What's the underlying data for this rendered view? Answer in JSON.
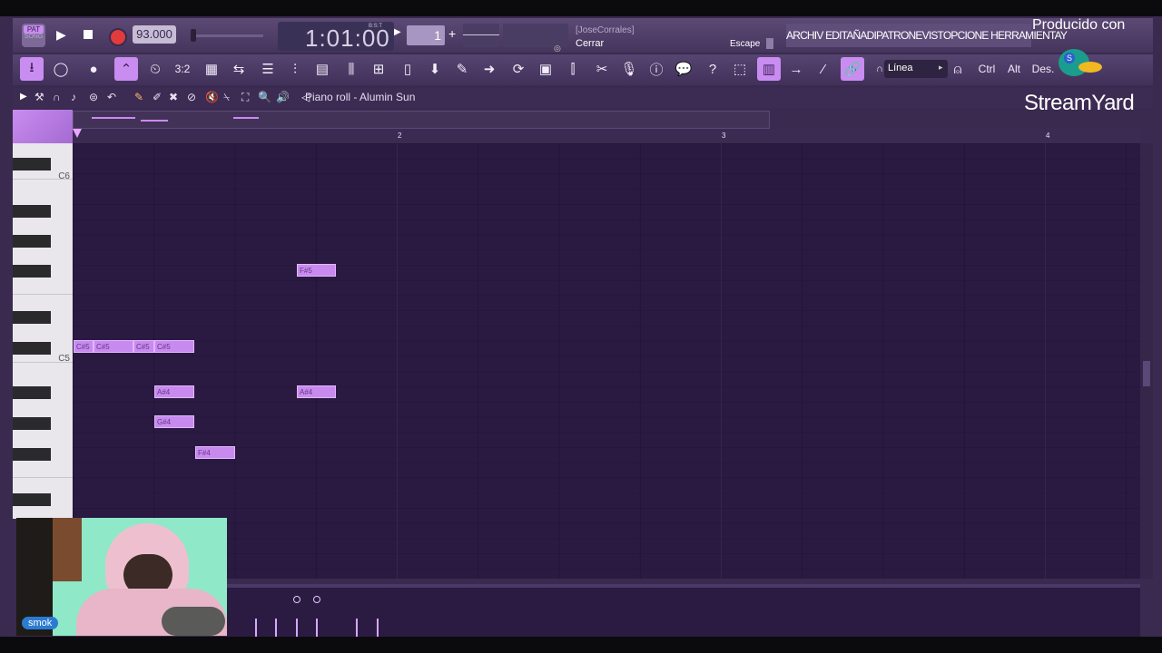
{
  "transport": {
    "pat_label": "PAT",
    "song_label": "SONG",
    "tempo": "93.000",
    "time": "1:01:00",
    "time_unit": "B:S:T",
    "pattern_number": "1",
    "hint_user": "[JoseCorrales]",
    "hint_text": "Cerrar",
    "hint_key": "Escape"
  },
  "menu": {
    "text": "ARCHIV EDITAÑADIPATRONEVISTOPCIONE HERRAMIENTAY"
  },
  "toolbar": {
    "snap_label": "Línea",
    "ctrl_label": "Ctrl",
    "alt_label": "Alt",
    "des_label": "Des."
  },
  "piano_roll": {
    "title": "Piano roll - Alumin Sun",
    "ruler_labels": [
      "2",
      "3",
      "4"
    ],
    "key_labels": [
      "C6",
      "C5"
    ],
    "notes": [
      {
        "label": "F#5"
      },
      {
        "label": "C#5"
      },
      {
        "label": "C#5"
      },
      {
        "label": "C#5"
      },
      {
        "label": "C#5"
      },
      {
        "label": "A#4"
      },
      {
        "label": "A#4"
      },
      {
        "label": "G#4"
      },
      {
        "label": "F#4"
      }
    ]
  },
  "overlay": {
    "producido": "Producido con",
    "brand": "StreamYard",
    "webcam_name": "smok"
  },
  "colors": {
    "note_fill": "#c98af0",
    "grid_bg": "#2a1a42",
    "toolbar_bg": "#564570",
    "highlight": "#c98cf0"
  }
}
